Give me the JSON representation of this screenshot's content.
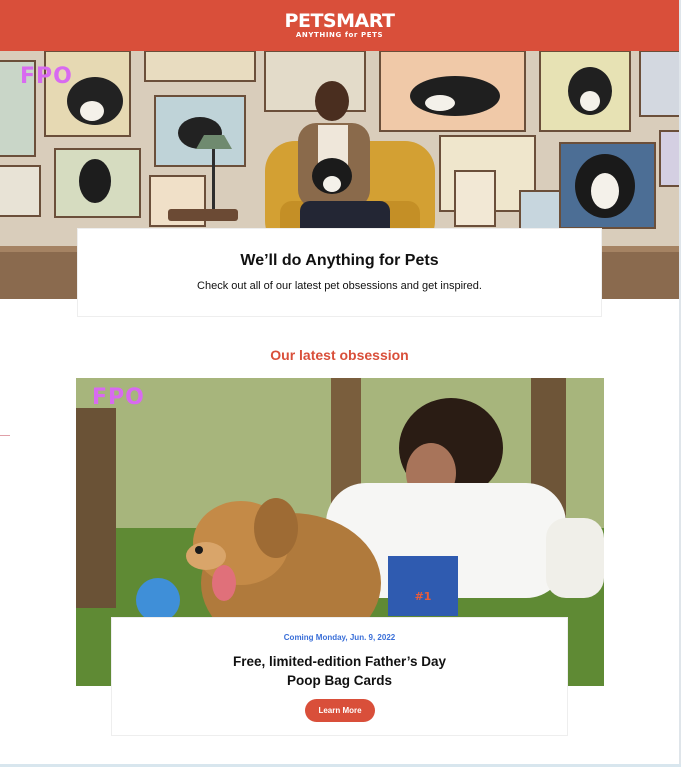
{
  "header": {
    "logo_main": "PETSMART",
    "logo_tagline": "ANYTHING for PETS",
    "background_color": "#d94f3a"
  },
  "hero": {
    "fpo_label": "FPO",
    "title": "We’ll do Anything for Pets",
    "subtitle": "Check out all of our latest pet obsessions and get inspired."
  },
  "section": {
    "heading": "Our latest obsession"
  },
  "feature": {
    "fpo_label": "FPO",
    "date": "Coming Monday, Jun. 9, 2022",
    "title_line1": "Free, limited-edition Father’s Day",
    "title_line2": "Poop Bag Cards",
    "button_label": "Learn More",
    "card_badge": "#1"
  },
  "colors": {
    "brand_red": "#d94f3a",
    "date_blue": "#3a6fd8",
    "fpo_magenta": "#d86af0"
  }
}
